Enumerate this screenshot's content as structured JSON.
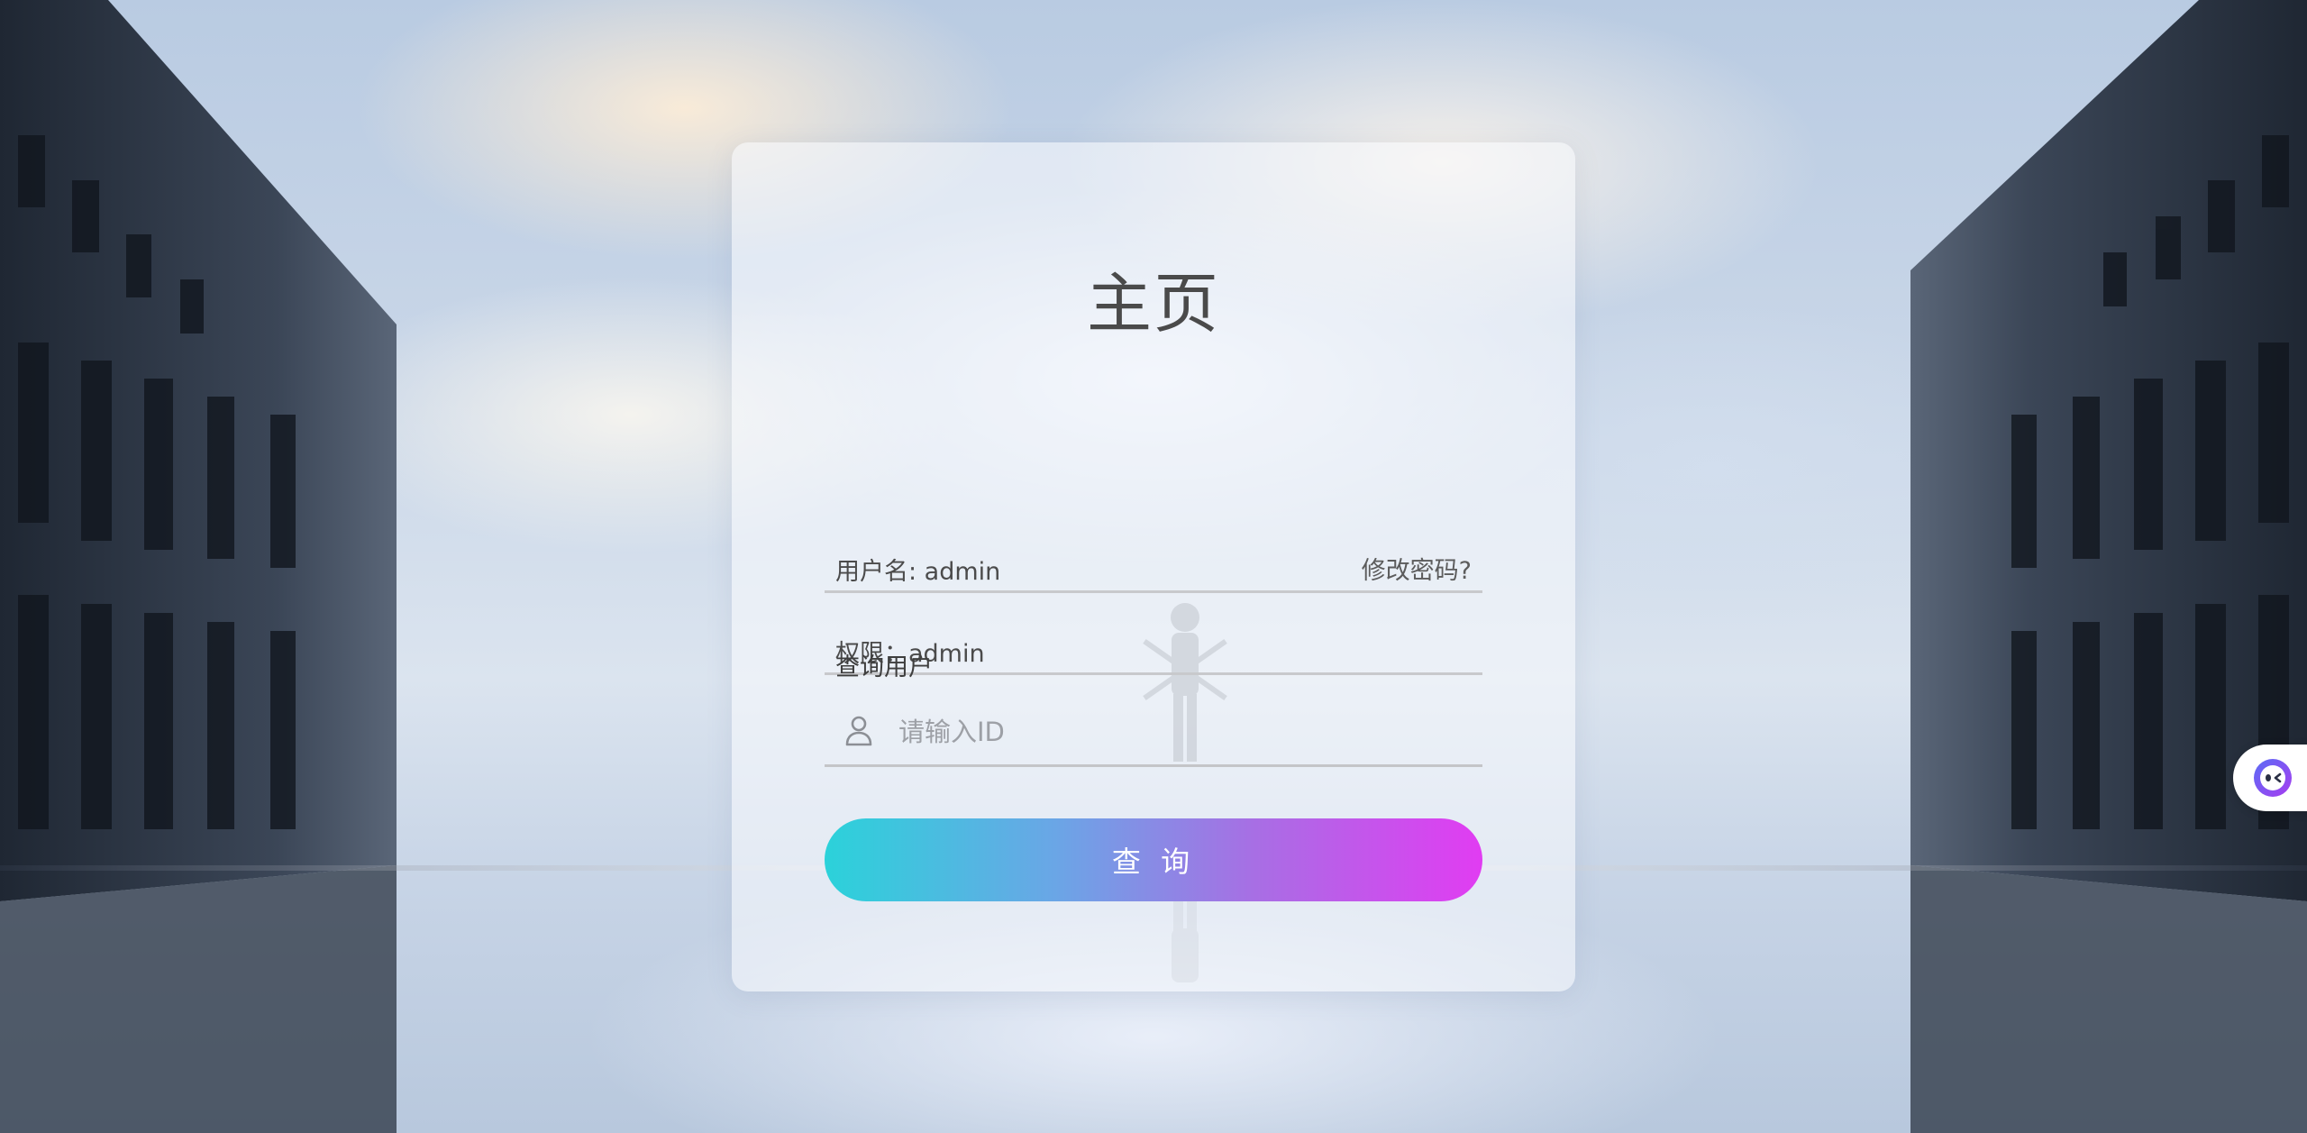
{
  "page": {
    "title": "主页"
  },
  "user_info": {
    "username_text": "用户名: admin",
    "role_text": "权限：admin"
  },
  "change_password": {
    "label": "修改密码?"
  },
  "query": {
    "section_label": "查询用户",
    "input_placeholder": "请输入ID",
    "input_value": "",
    "icon": "user-icon",
    "button_label": "查 询"
  },
  "floating_widget": {
    "icon": "chat-bot-icon"
  },
  "colors": {
    "button_gradient_start": "#2bd2da",
    "button_gradient_end": "#e13cf2",
    "title_text": "#4a4a4a",
    "card_background": "rgba(248,249,253,0.58)"
  }
}
